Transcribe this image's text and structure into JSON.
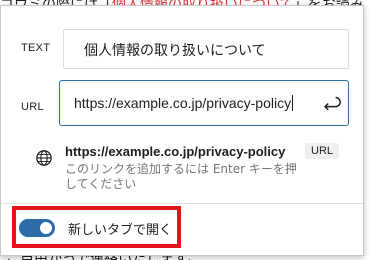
{
  "background": {
    "top_text_prefix": "ゴウミの際には「",
    "top_text_link": "個人情報の取り扱いについて",
    "top_text_suffix": "」をお読み",
    "bottom_text": "ご自由かっで連絡いたします。"
  },
  "link_popover": {
    "text_label": "TEXT",
    "text_value": "個人情報の取り扱いについて",
    "url_label": "URL",
    "url_value": "https://example.co.jp/privacy-policy",
    "suggestion": {
      "url": "https://example.co.jp/privacy-policy",
      "hint": "このリンクを追加するには Enter キーを押してください",
      "badge": "URL"
    },
    "toggle": {
      "label": "新しいタブで開く",
      "checked": true
    }
  },
  "colors": {
    "accent": "#2d6ca8",
    "highlight_border": "#e3131a",
    "link_red": "#d63638"
  },
  "icons": {
    "submit": "enter-return-icon",
    "suggestion": "globe-icon"
  }
}
